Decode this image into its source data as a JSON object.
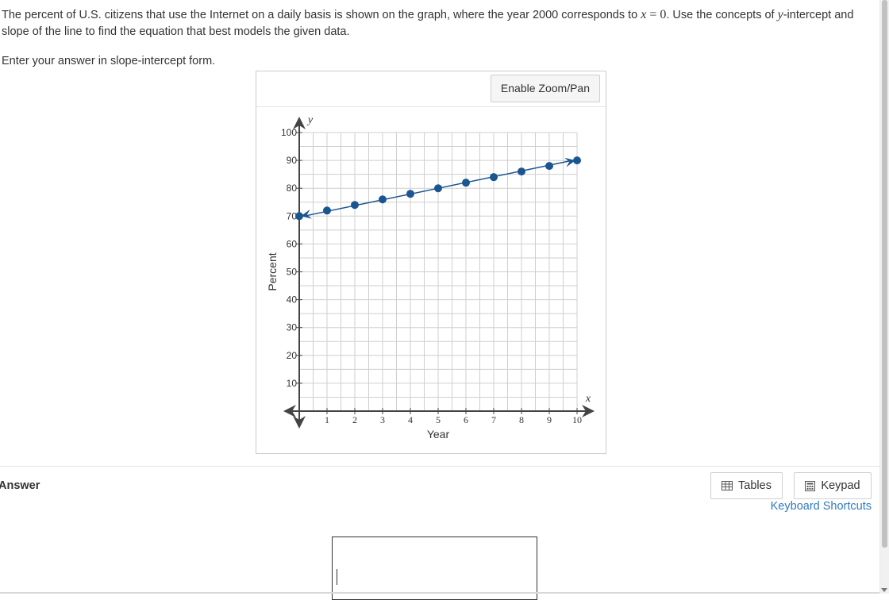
{
  "problem": {
    "part1": "The percent of U.S. citizens that use the Internet on a daily basis is shown on the graph, where the year 2000 corresponds to ",
    "var_x": "x",
    "eq": " = 0",
    "part2": ". Use the concepts of ",
    "var_y": "y",
    "part3": "-intercept and slope of the line to find the equation that best models the given data.",
    "instruction": "Enter your answer in slope-intercept form."
  },
  "graph": {
    "zoom_button": "Enable Zoom/Pan"
  },
  "answer": {
    "label": "Answer",
    "tables_button": "Tables",
    "keypad_button": "Keypad",
    "keyboard_shortcuts": "Keyboard Shortcuts",
    "value": ""
  },
  "chart_data": {
    "type": "scatter",
    "xlabel": "Year",
    "ylabel": "Percent",
    "x_axis_var": "x",
    "y_axis_var": "y",
    "xlim": [
      0,
      10
    ],
    "ylim": [
      0,
      100
    ],
    "x_ticks": [
      1,
      2,
      3,
      4,
      5,
      6,
      7,
      8,
      9,
      10
    ],
    "y_ticks": [
      10,
      20,
      30,
      40,
      50,
      60,
      70,
      80,
      90,
      100
    ],
    "grid": true,
    "points": [
      {
        "x": 0,
        "y": 70
      },
      {
        "x": 1,
        "y": 72
      },
      {
        "x": 2,
        "y": 74
      },
      {
        "x": 3,
        "y": 76
      },
      {
        "x": 4,
        "y": 78
      },
      {
        "x": 5,
        "y": 80
      },
      {
        "x": 6,
        "y": 82
      },
      {
        "x": 7,
        "y": 84
      },
      {
        "x": 8,
        "y": 86
      },
      {
        "x": 9,
        "y": 88
      },
      {
        "x": 10,
        "y": 90
      }
    ],
    "line": {
      "x1": 0,
      "y1": 70,
      "x2": 10,
      "y2": 90
    },
    "colors": {
      "points": "#1b5590",
      "line": "#1b5590",
      "axis": "#444444",
      "grid": "#cfcfcf"
    }
  }
}
